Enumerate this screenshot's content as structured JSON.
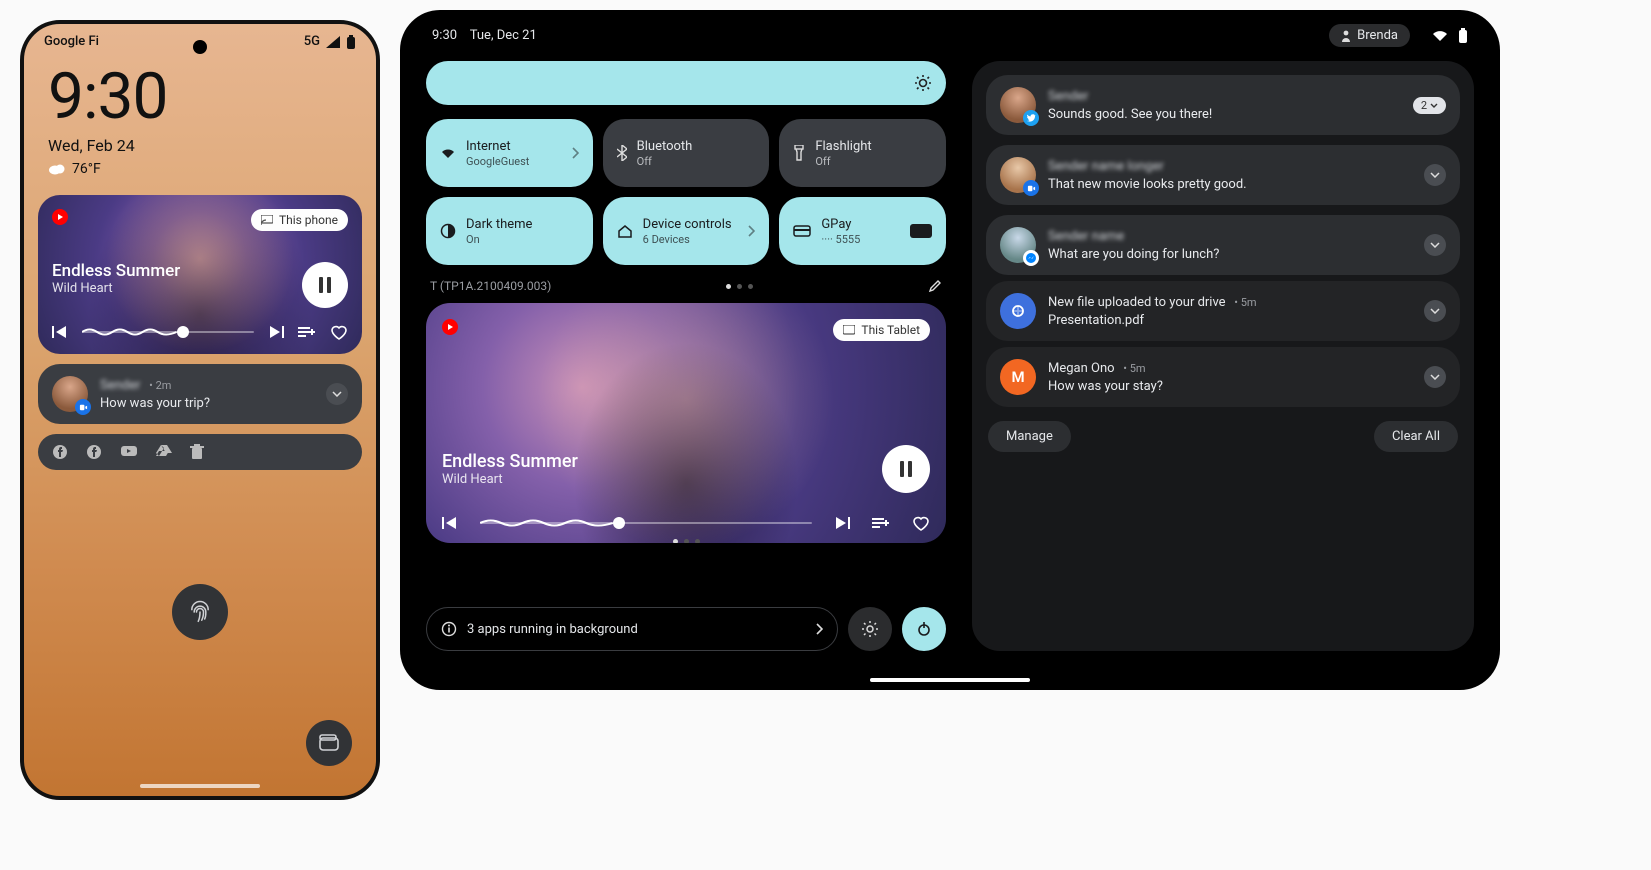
{
  "phone": {
    "carrier": "Google Fi",
    "network": "5G",
    "clock": "9:30",
    "date": "Wed, Feb 24",
    "temp": "76°F",
    "media": {
      "output_chip": "This phone",
      "title": "Endless Summer",
      "artist": "Wild Heart"
    },
    "notification": {
      "time": "2m",
      "message": "How was your trip?"
    },
    "app_icons": [
      "facebook-icon",
      "facebook-icon",
      "youtube-icon",
      "drive-icon",
      "trash-icon"
    ]
  },
  "tablet": {
    "status_time": "9:30",
    "status_date": "Tue, Dec 21",
    "user": "Brenda",
    "build": "T (TP1A.2100409.003)",
    "qs": {
      "internet_label": "Internet",
      "internet_sub": "GoogleGuest",
      "bluetooth_label": "Bluetooth",
      "bluetooth_sub": "Off",
      "flashlight_label": "Flashlight",
      "flashlight_sub": "Off",
      "darktheme_label": "Dark theme",
      "darktheme_sub": "On",
      "devicectl_label": "Device controls",
      "devicectl_sub": "6 Devices",
      "gpay_label": "GPay",
      "gpay_sub": "···· 5555"
    },
    "media": {
      "output_chip": "This Tablet",
      "title": "Endless Summer",
      "artist": "Wild Heart"
    },
    "bg_apps": "3 apps running in background",
    "notifications": [
      {
        "message": "Sounds good. See you there!",
        "badge": "2",
        "time": "",
        "app": "twitter"
      },
      {
        "message": "That new movie looks pretty good.",
        "time": "",
        "app": "duo"
      },
      {
        "message": "What are you doing for lunch?",
        "time": "",
        "app": "messenger"
      },
      {
        "title": "New file uploaded to your drive",
        "message": "Presentation.pdf",
        "time": "5m",
        "app": "drive"
      },
      {
        "title": "Megan Ono",
        "message": "How was your stay?",
        "time": "5m",
        "app": "m"
      }
    ],
    "manage": "Manage",
    "clear_all": "Clear All"
  }
}
